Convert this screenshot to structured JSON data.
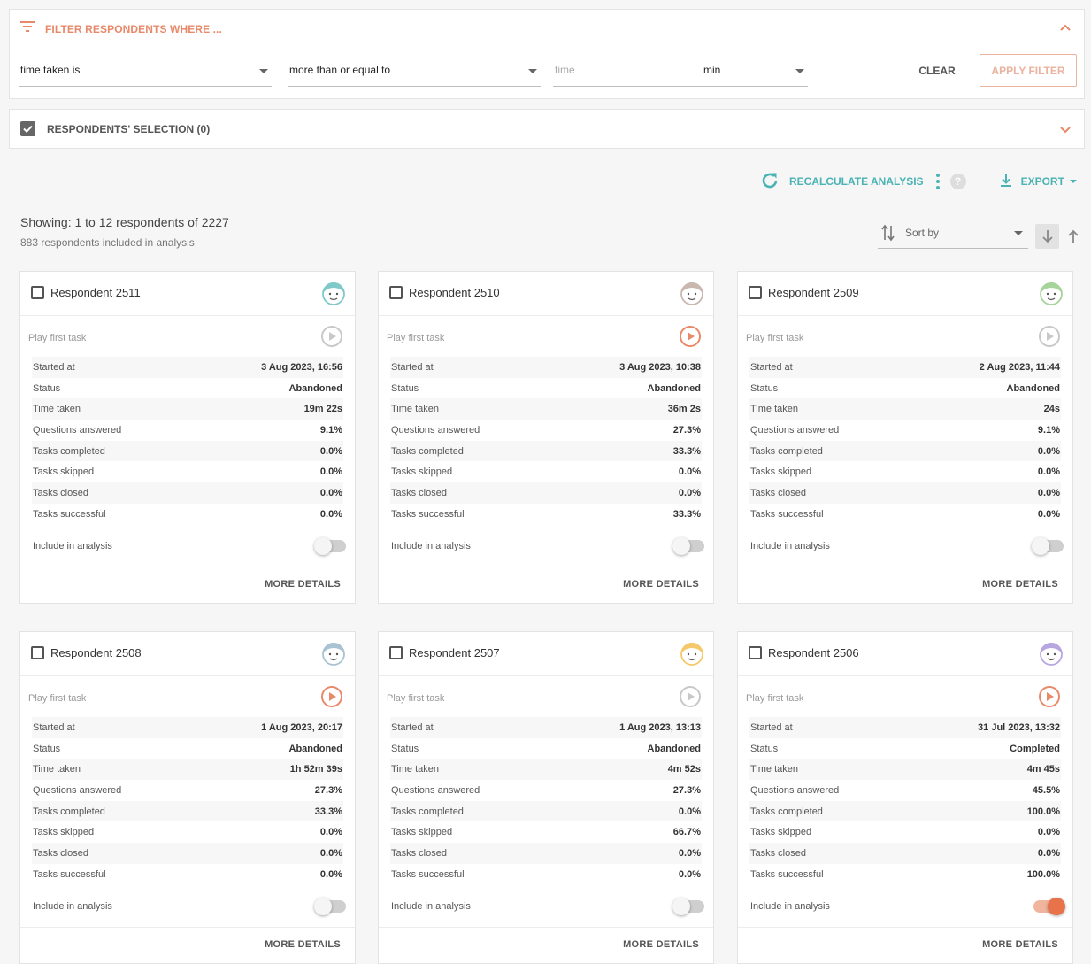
{
  "filter": {
    "title": "FILTER RESPONDENTS WHERE ...",
    "field": "time taken is",
    "operator": "more than or equal to",
    "value_placeholder": "time",
    "unit": "min",
    "clear_label": "CLEAR",
    "apply_label": "APPLY FILTER"
  },
  "selection": {
    "title": "RESPONDENTS' SELECTION (0)"
  },
  "toolbar": {
    "recalc_label": "RECALCULATE ANALYSIS",
    "help_label": "?",
    "export_label": "EXPORT"
  },
  "summary": {
    "showing": "Showing: 1 to 12 respondents of 2227",
    "included": "883 respondents included in analysis"
  },
  "sort": {
    "label": "Sort by"
  },
  "colors": {
    "accent": "#e8896a",
    "teal": "#4ab3b3"
  },
  "card_labels": {
    "play": "Play first task",
    "started": "Started at",
    "status": "Status",
    "time": "Time taken",
    "questions": "Questions answered",
    "completed": "Tasks completed",
    "skipped": "Tasks skipped",
    "closed": "Tasks closed",
    "successful": "Tasks successful",
    "include": "Include in analysis",
    "more": "MORE DETAILS"
  },
  "respondents": [
    {
      "name": "Respondent 2511",
      "avatar_color": "#7fc9c9",
      "play_active": false,
      "started": "3 Aug 2023, 16:56",
      "status": "Abandoned",
      "time": "19m 22s",
      "questions": "9.1%",
      "completed": "0.0%",
      "skipped": "0.0%",
      "closed": "0.0%",
      "successful": "0.0%",
      "included": false
    },
    {
      "name": "Respondent 2510",
      "avatar_color": "#c9b8b0",
      "play_active": true,
      "started": "3 Aug 2023, 10:38",
      "status": "Abandoned",
      "time": "36m 2s",
      "questions": "27.3%",
      "completed": "33.3%",
      "skipped": "0.0%",
      "closed": "0.0%",
      "successful": "33.3%",
      "included": false
    },
    {
      "name": "Respondent 2509",
      "avatar_color": "#a7d49a",
      "play_active": false,
      "started": "2 Aug 2023, 11:44",
      "status": "Abandoned",
      "time": "24s",
      "questions": "9.1%",
      "completed": "0.0%",
      "skipped": "0.0%",
      "closed": "0.0%",
      "successful": "0.0%",
      "included": false
    },
    {
      "name": "Respondent 2508",
      "avatar_color": "#a9c3d3",
      "play_active": true,
      "started": "1 Aug 2023, 20:17",
      "status": "Abandoned",
      "time": "1h 52m 39s",
      "questions": "27.3%",
      "completed": "33.3%",
      "skipped": "0.0%",
      "closed": "0.0%",
      "successful": "0.0%",
      "included": false
    },
    {
      "name": "Respondent 2507",
      "avatar_color": "#f5c96b",
      "play_active": false,
      "started": "1 Aug 2023, 13:13",
      "status": "Abandoned",
      "time": "4m 52s",
      "questions": "27.3%",
      "completed": "0.0%",
      "skipped": "66.7%",
      "closed": "0.0%",
      "successful": "0.0%",
      "included": false
    },
    {
      "name": "Respondent 2506",
      "avatar_color": "#b7a6e0",
      "play_active": true,
      "started": "31 Jul 2023, 13:32",
      "status": "Completed",
      "time": "4m 45s",
      "questions": "45.5%",
      "completed": "100.0%",
      "skipped": "0.0%",
      "closed": "0.0%",
      "successful": "100.0%",
      "included": true
    }
  ]
}
